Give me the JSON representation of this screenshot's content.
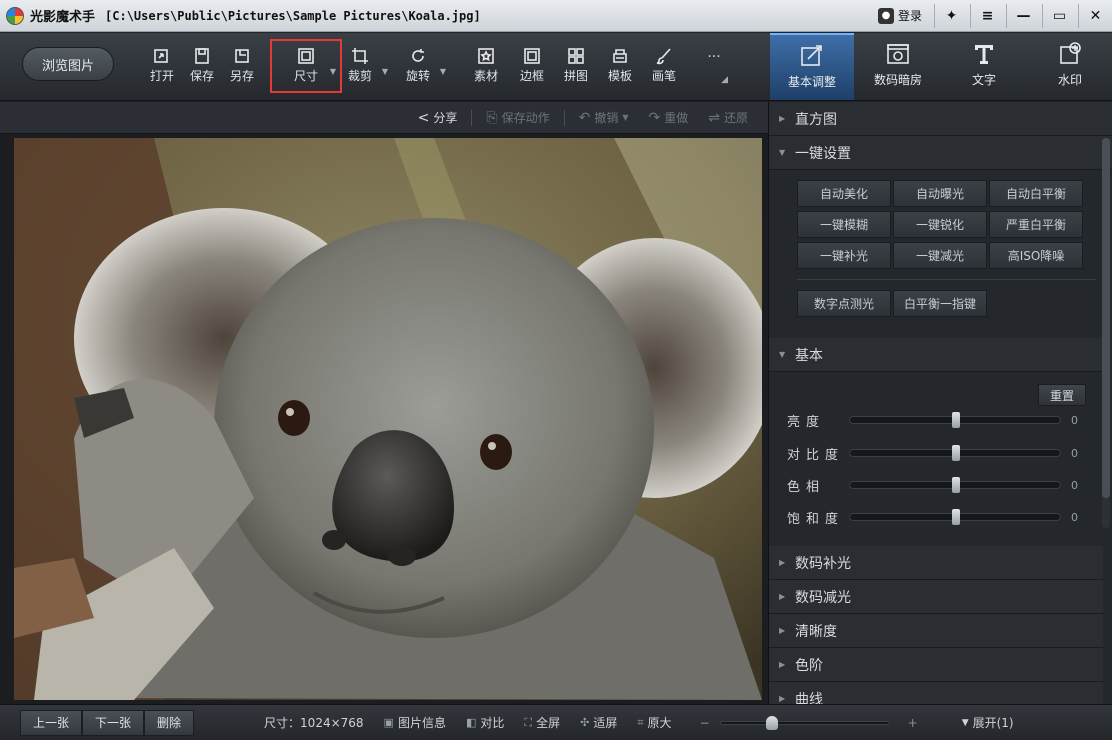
{
  "titlebar": {
    "app_name": "光影魔术手",
    "file_path": "[C:\\Users\\Public\\Pictures\\Sample Pictures\\Koala.jpg]",
    "login_label": "登录",
    "login_icon": "user-icon",
    "win_buttons": [
      "pin-icon",
      "menu-icon",
      "minimize-icon",
      "maximize-icon",
      "close-icon"
    ]
  },
  "toolbar": {
    "browse_label": "浏览图片",
    "tools": [
      {
        "label": "打开",
        "icon": "open-icon"
      },
      {
        "label": "保存",
        "icon": "save-icon"
      },
      {
        "label": "另存",
        "icon": "save-as-icon"
      },
      {
        "label": "尺寸",
        "icon": "resize-icon"
      },
      {
        "label": "裁剪",
        "icon": "crop-icon"
      },
      {
        "label": "旋转",
        "icon": "rotate-icon"
      },
      {
        "label": "素材",
        "icon": "material-icon"
      },
      {
        "label": "边框",
        "icon": "border-icon"
      },
      {
        "label": "拼图",
        "icon": "collage-icon"
      },
      {
        "label": "模板",
        "icon": "template-icon"
      },
      {
        "label": "画笔",
        "icon": "brush-icon"
      },
      {
        "label": "",
        "icon": "more-icon",
        "glyph": "···"
      }
    ],
    "right_tabs": [
      {
        "label": "基本调整",
        "icon": "basic-adjust-icon",
        "active": true
      },
      {
        "label": "数码暗房",
        "icon": "darkroom-icon",
        "active": false
      },
      {
        "label": "文字",
        "icon": "text-icon",
        "active": false
      },
      {
        "label": "水印",
        "icon": "watermark-icon",
        "active": false
      }
    ]
  },
  "actionbar": {
    "share": "分享",
    "save_action": "保存动作",
    "undo": "撤销",
    "redo": "重做",
    "restore": "还原"
  },
  "panel": {
    "histogram": "直方图",
    "one_click": "一键设置",
    "one_click_buttons": [
      "自动美化",
      "自动曝光",
      "自动白平衡",
      "一键模糊",
      "一键锐化",
      "严重白平衡",
      "一键补光",
      "一键减光",
      "高ISO降噪"
    ],
    "extra_buttons": [
      "数字点测光",
      "白平衡一指键"
    ],
    "basic": "基本",
    "reset": "重置",
    "sliders": [
      {
        "label": "亮度",
        "value": "0",
        "fraction": 0.5
      },
      {
        "label": "对比度",
        "value": "0",
        "fraction": 0.5
      },
      {
        "label": "色相",
        "value": "0",
        "fraction": 0.5
      },
      {
        "label": "饱和度",
        "value": "0",
        "fraction": 0.5
      }
    ],
    "sections": [
      "数码补光",
      "数码减光",
      "清晰度",
      "色阶",
      "曲线"
    ]
  },
  "statusbar": {
    "prev": "上一张",
    "next": "下一张",
    "delete": "删除",
    "size": "尺寸：1024×768",
    "info": "图片信息",
    "compare": "对比",
    "fullscreen": "全屏",
    "fit": "适屏",
    "original": "原大",
    "zoom_minus": "−",
    "zoom_plus": "+",
    "zoom_fraction": 0.3,
    "expand": "展开(1)"
  }
}
